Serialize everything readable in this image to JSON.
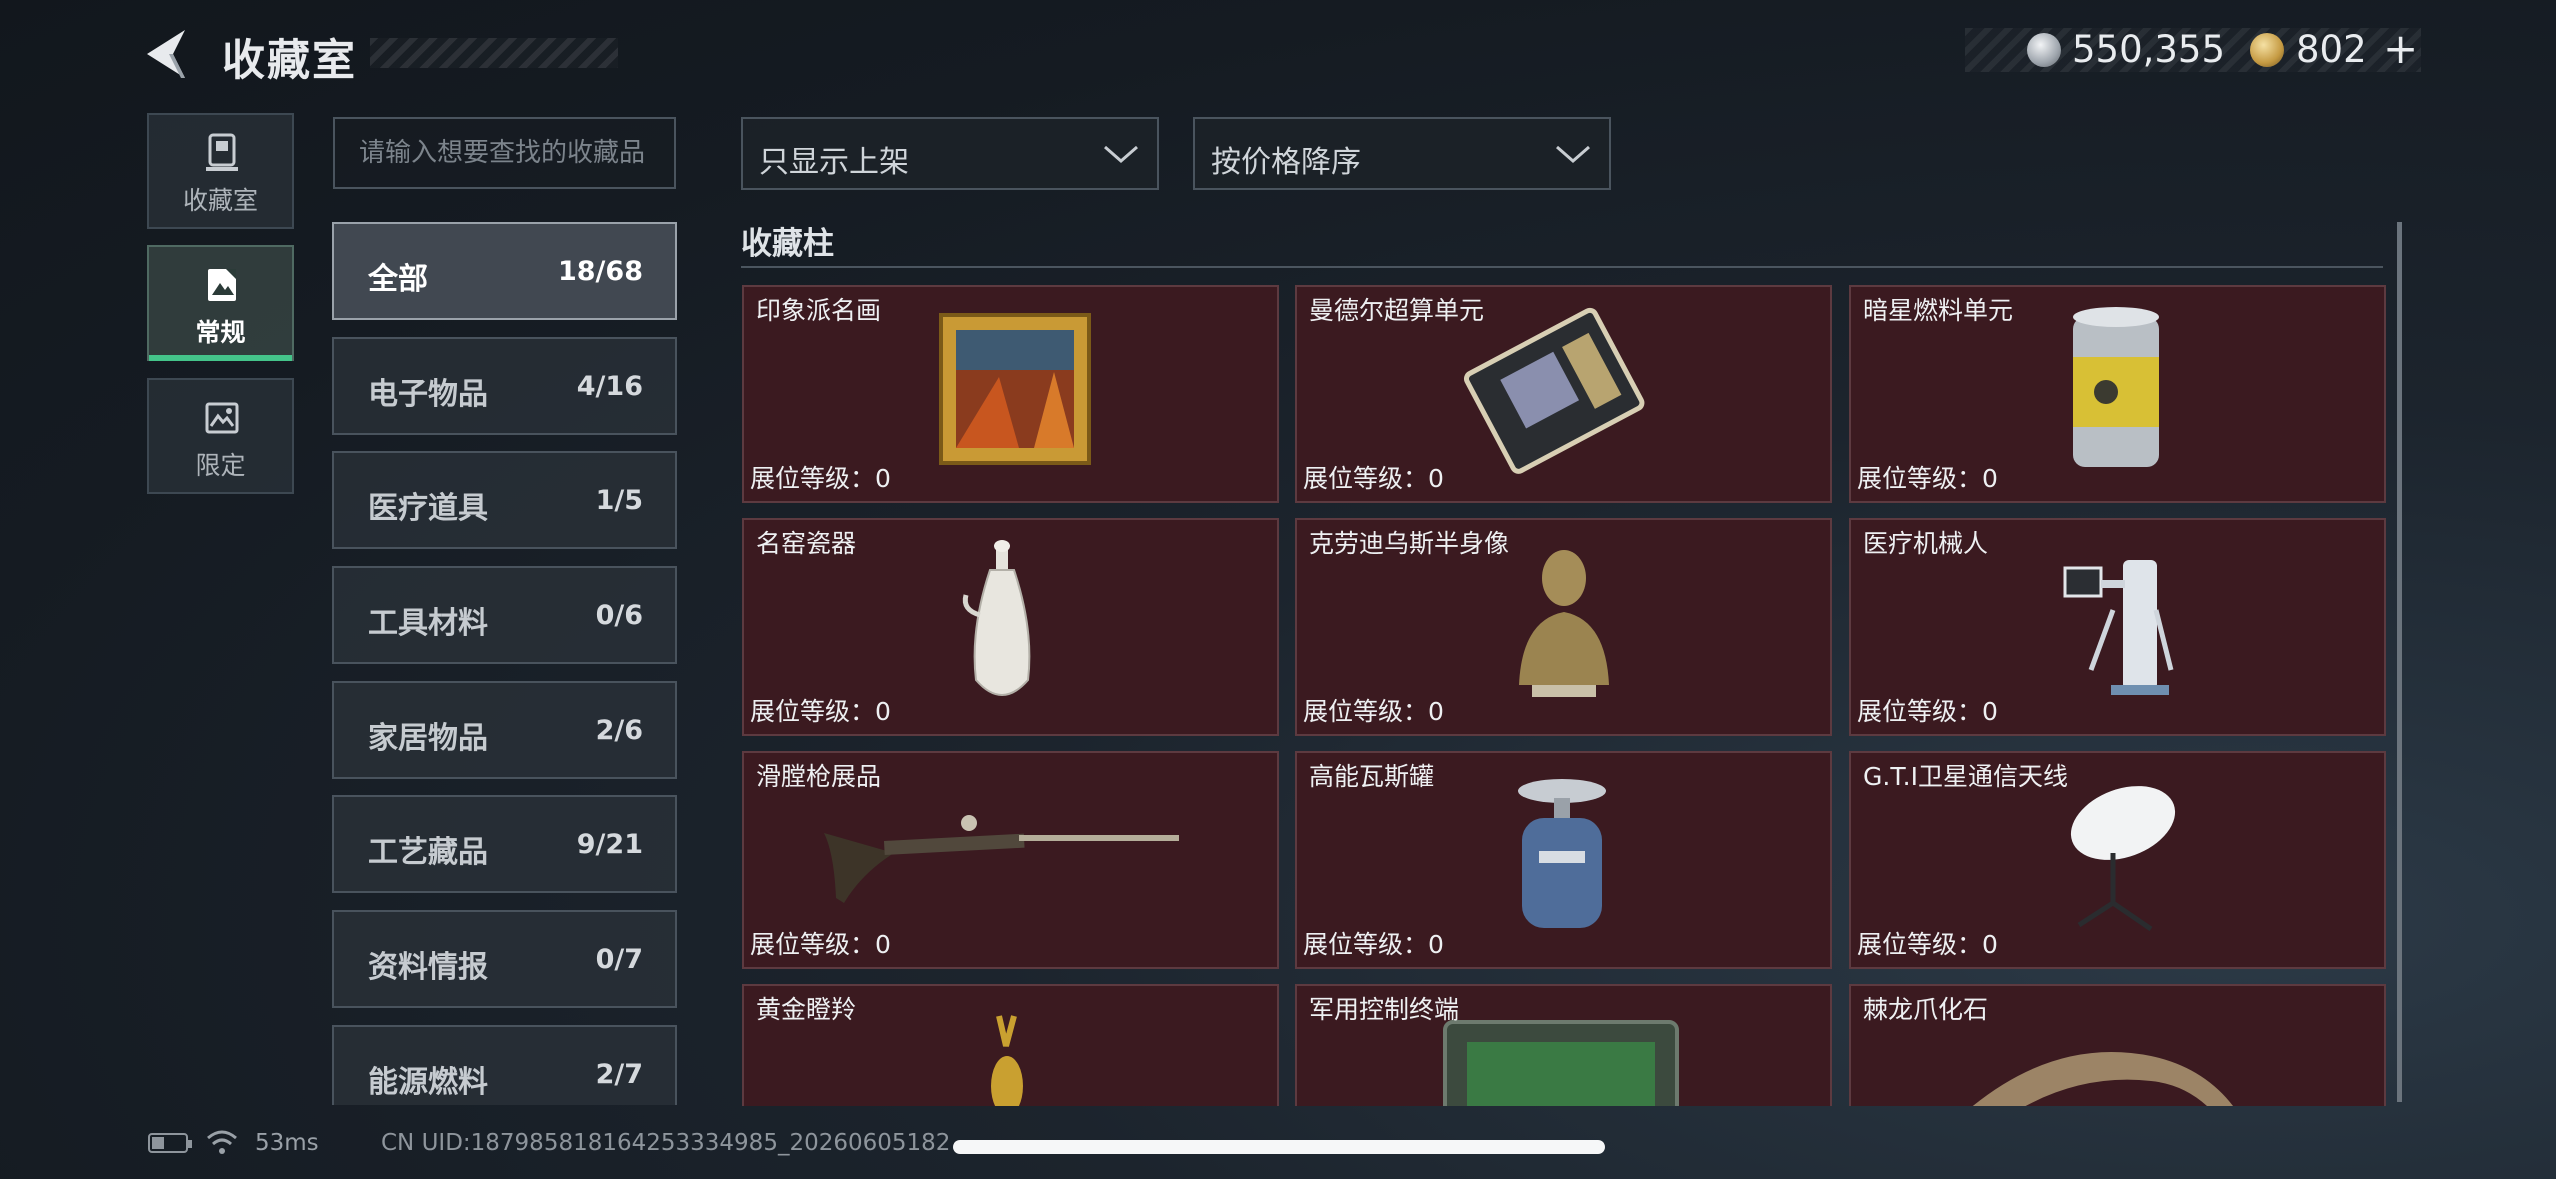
{
  "header": {
    "title": "收藏室",
    "currency": {
      "silver": "550,355",
      "gold": "802",
      "plus": "+"
    }
  },
  "side_nav": [
    {
      "label": "收藏室",
      "icon": "collection-room-icon"
    },
    {
      "label": "常规",
      "icon": "regular-album-icon",
      "active": true
    },
    {
      "label": "限定",
      "icon": "limited-photo-icon"
    }
  ],
  "search": {
    "placeholder": "请输入想要查找的收藏品",
    "value": ""
  },
  "categories": [
    {
      "name": "全部",
      "count": "18/68",
      "active": true
    },
    {
      "name": "电子物品",
      "count": "4/16"
    },
    {
      "name": "医疗道具",
      "count": "1/5"
    },
    {
      "name": "工具材料",
      "count": "0/6"
    },
    {
      "name": "家居物品",
      "count": "2/6"
    },
    {
      "name": "工艺藏品",
      "count": "9/21"
    },
    {
      "name": "资料情报",
      "count": "0/7"
    },
    {
      "name": "能源燃料",
      "count": "2/7"
    }
  ],
  "filters": {
    "display": "只显示上架",
    "sort": "按价格降序"
  },
  "cabinet": {
    "title": "收藏柱",
    "level_label": "展位等级：0",
    "items": [
      {
        "name": "印象派名画",
        "icon": "painting-icon"
      },
      {
        "name": "曼德尔超算单元",
        "icon": "supercomputer-unit-icon"
      },
      {
        "name": "暗星燃料单元",
        "icon": "fuel-canister-icon"
      },
      {
        "name": "名窑瓷器",
        "icon": "porcelain-vase-icon"
      },
      {
        "name": "克劳迪乌斯半身像",
        "icon": "bust-statue-icon"
      },
      {
        "name": "医疗机械人",
        "icon": "medical-robot-icon"
      },
      {
        "name": "滑膛枪展品",
        "icon": "musket-icon"
      },
      {
        "name": "高能瓦斯罐",
        "icon": "gas-tank-icon"
      },
      {
        "name": "G.T.I卫星通信天线",
        "icon": "satellite-dish-icon"
      },
      {
        "name": "黄金瞪羚",
        "icon": "gold-gazelle-icon"
      },
      {
        "name": "军用控制终端",
        "icon": "military-terminal-icon"
      },
      {
        "name": "棘龙爪化石",
        "icon": "claw-fossil-icon"
      }
    ]
  },
  "footer": {
    "ping": "53ms",
    "uid": "CN UID:187985818164253334985_20260605182"
  },
  "colors": {
    "card_bg": "#3b1a20",
    "active_accent": "#44c48a"
  }
}
